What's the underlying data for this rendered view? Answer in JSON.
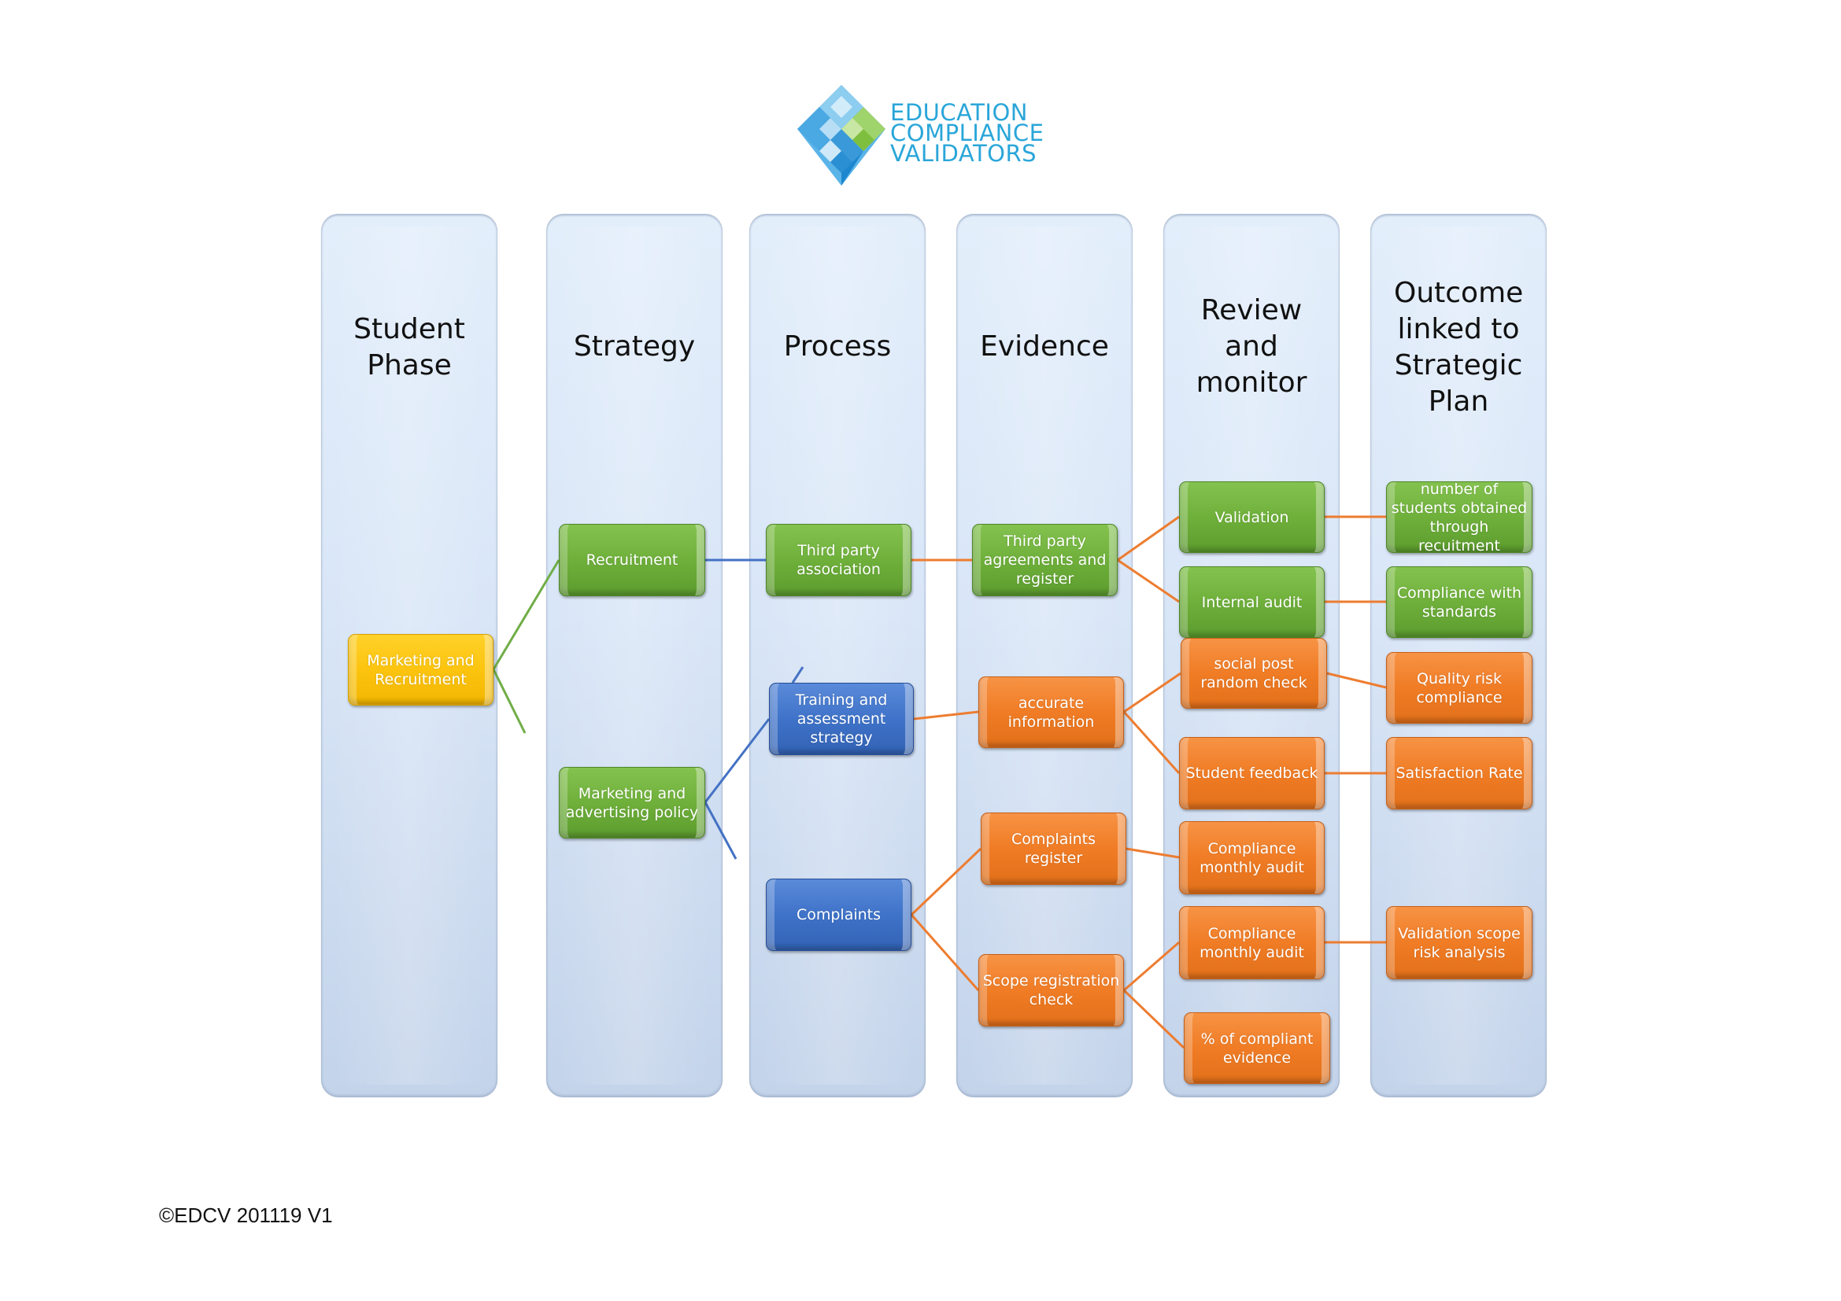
{
  "logo": {
    "icon": "diamond-mosaic-icon",
    "lines": [
      "EDUCATION",
      "COMPLIANCE",
      "VALIDATORS"
    ],
    "colors": {
      "text": "#2aa6d9",
      "blue": "#3aa3e0",
      "green": "#8cc63f"
    }
  },
  "columns": [
    {
      "title": "Student Phase"
    },
    {
      "title": "Strategy"
    },
    {
      "title": "Process"
    },
    {
      "title": "Evidence"
    },
    {
      "title": "Review and monitor"
    },
    {
      "title": "Outcome linked to Strategic Plan"
    }
  ],
  "nodes": {
    "marketing_recruitment": {
      "label": "Marketing and Recruitment",
      "color": "yellow"
    },
    "recruitment": {
      "label": "Recruitment",
      "color": "green"
    },
    "marketing_policy": {
      "label": "Marketing and advertising policy",
      "color": "green"
    },
    "third_party_assoc": {
      "label": "Third party association",
      "color": "green"
    },
    "training_strategy": {
      "label": "Training and assessment strategy",
      "color": "blue"
    },
    "complaints": {
      "label": "Complaints",
      "color": "blue"
    },
    "third_party_agreements": {
      "label": "Third party agreements and register",
      "color": "green"
    },
    "accurate_info": {
      "label": "accurate information",
      "color": "orange"
    },
    "complaints_register": {
      "label": "Complaints register",
      "color": "orange"
    },
    "scope_check": {
      "label": "Scope registration check",
      "color": "orange"
    },
    "validation": {
      "label": "Validation",
      "color": "green"
    },
    "internal_audit": {
      "label": "Internal audit",
      "color": "green"
    },
    "social_post": {
      "label": "social post random check",
      "color": "orange"
    },
    "student_feedback": {
      "label": "Student feedback",
      "color": "orange"
    },
    "compliance_audit_1": {
      "label": "Compliance monthly audit",
      "color": "orange"
    },
    "compliance_audit_2": {
      "label": "Compliance monthly audit",
      "color": "orange"
    },
    "pct_compliant": {
      "label": "% of compliant evidence",
      "color": "orange"
    },
    "num_students": {
      "label": "number of students obtained through recuitment",
      "color": "green"
    },
    "compliance_standards": {
      "label": "Compliance with standards",
      "color": "green"
    },
    "quality_risk": {
      "label": "Quality risk compliance",
      "color": "orange"
    },
    "satisfaction_rate": {
      "label": "Satisfaction Rate",
      "color": "orange"
    },
    "validation_scope": {
      "label": "Validation scope risk analysis",
      "color": "orange"
    }
  },
  "connections": [
    {
      "from": "marketing_recruitment",
      "to": "recruitment",
      "color": "green"
    },
    {
      "from": "marketing_recruitment",
      "to": "(open end)",
      "color": "green"
    },
    {
      "from": "recruitment",
      "to": "third_party_assoc",
      "color": "blue"
    },
    {
      "from": "marketing_policy",
      "to": "training_strategy",
      "color": "blue"
    },
    {
      "from": "marketing_policy",
      "to": "(open end)",
      "color": "blue"
    },
    {
      "from": "third_party_assoc",
      "to": "third_party_agreements",
      "color": "orange"
    },
    {
      "from": "training_strategy",
      "to": "accurate_info",
      "color": "orange"
    },
    {
      "from": "complaints",
      "to": "complaints_register",
      "color": "orange"
    },
    {
      "from": "complaints",
      "to": "scope_check",
      "color": "orange"
    },
    {
      "from": "third_party_agreements",
      "to": "validation",
      "color": "orange"
    },
    {
      "from": "third_party_agreements",
      "to": "internal_audit",
      "color": "orange"
    },
    {
      "from": "accurate_info",
      "to": "social_post",
      "color": "orange"
    },
    {
      "from": "accurate_info",
      "to": "student_feedback",
      "color": "orange"
    },
    {
      "from": "complaints_register",
      "to": "compliance_audit_1",
      "color": "orange"
    },
    {
      "from": "scope_check",
      "to": "compliance_audit_2",
      "color": "orange"
    },
    {
      "from": "scope_check",
      "to": "pct_compliant",
      "color": "orange"
    },
    {
      "from": "validation",
      "to": "num_students",
      "color": "orange"
    },
    {
      "from": "internal_audit",
      "to": "compliance_standards",
      "color": "orange"
    },
    {
      "from": "social_post",
      "to": "quality_risk",
      "color": "orange"
    },
    {
      "from": "student_feedback",
      "to": "satisfaction_rate",
      "color": "orange"
    },
    {
      "from": "compliance_audit_2",
      "to": "validation_scope",
      "color": "orange"
    }
  ],
  "line_colors": {
    "green": "#70ad47",
    "blue": "#4472c4",
    "orange": "#ed7d31"
  },
  "footer": "©EDCV 201119 V1"
}
